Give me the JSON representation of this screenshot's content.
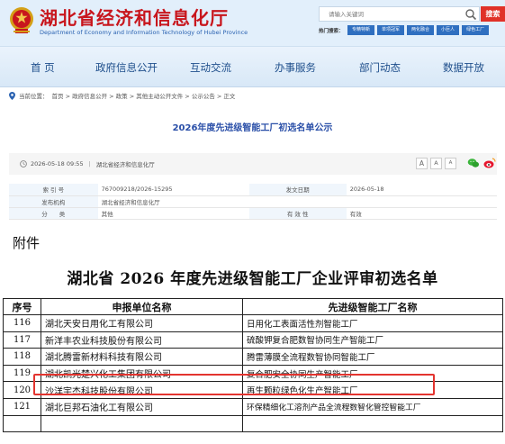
{
  "header": {
    "site_title": "湖北省经济和信息化厅",
    "site_subtitle": "Department of Economy and Information Technology of Hubei Province",
    "search_placeholder": "请输入关键词",
    "search_button": "搜索",
    "hot_label": "热门搜索：",
    "hot_tags": [
      "专精特新",
      "单项冠军",
      "两化融合",
      "小巨人",
      "绿色工厂"
    ]
  },
  "nav": {
    "items": [
      "首 页",
      "政府信息公开",
      "互动交流",
      "办事服务",
      "部门动态",
      "数据开放"
    ]
  },
  "breadcrumb": {
    "label": "当前位置：",
    "path": "首页 > 政府信息公开 > 政策 > 其他主动公开文件 > 公示公告 > 正文"
  },
  "notice": {
    "title": "2026年度先进级智能工厂初选名单公示",
    "date": "2026-05-18 09:55",
    "separator": "|",
    "source": "湖北省经济和信息化厅",
    "font_buttons": [
      "A",
      "A",
      "A"
    ]
  },
  "info_table": {
    "rows": [
      {
        "k1": "索 引 号",
        "v1": "767009218/2026-15295",
        "k2": "发文日期",
        "v2": "2026-05-18"
      },
      {
        "k1": "发布机构",
        "v1": "湖北省经济和信息化厅",
        "k2": "",
        "v2": ""
      },
      {
        "k1": "分　　类",
        "v1": "其他",
        "k2": "有 效 性",
        "v2": "有效"
      }
    ]
  },
  "attachment": {
    "label": "附件",
    "doc_title": "湖北省 2026 年度先进级智能工厂企业评审初选名单",
    "columns": [
      "序号",
      "申报单位名称",
      "先进级智能工厂名称"
    ],
    "rows": [
      {
        "no": "116",
        "company": "湖北天安日用化工有限公司",
        "factory": "日用化工表面活性剂智能工厂"
      },
      {
        "no": "117",
        "company": "新洋丰农业科技股份有限公司",
        "factory": "硫酸钾复合肥数智协同生产智能工厂"
      },
      {
        "no": "118",
        "company": "湖北腾雷新材料科技有限公司",
        "factory": "腾雷薄膜全流程数智协同智能工厂"
      },
      {
        "no": "119",
        "company": "湖北凯光楚兴化工集团有限公司",
        "factory": "复合肥安全协同生产智能工厂"
      },
      {
        "no": "120",
        "company": "沙洋宇杰科技股份有限公司",
        "factory": "再生颗粒绿色化生产智能工厂"
      },
      {
        "no": "121",
        "company": "湖北巨邦石油化工有限公司",
        "factory": "环保精细化工溶剂产品全流程数智化管控智能工厂"
      },
      {
        "no": "",
        "company": "",
        "factory": ""
      }
    ],
    "highlighted_row": "119"
  },
  "colors": {
    "brand_red": "#c8161d",
    "nav_blue": "#1f4f8c",
    "link_blue": "#2a4fa8",
    "highlight_red": "#e3342f"
  }
}
